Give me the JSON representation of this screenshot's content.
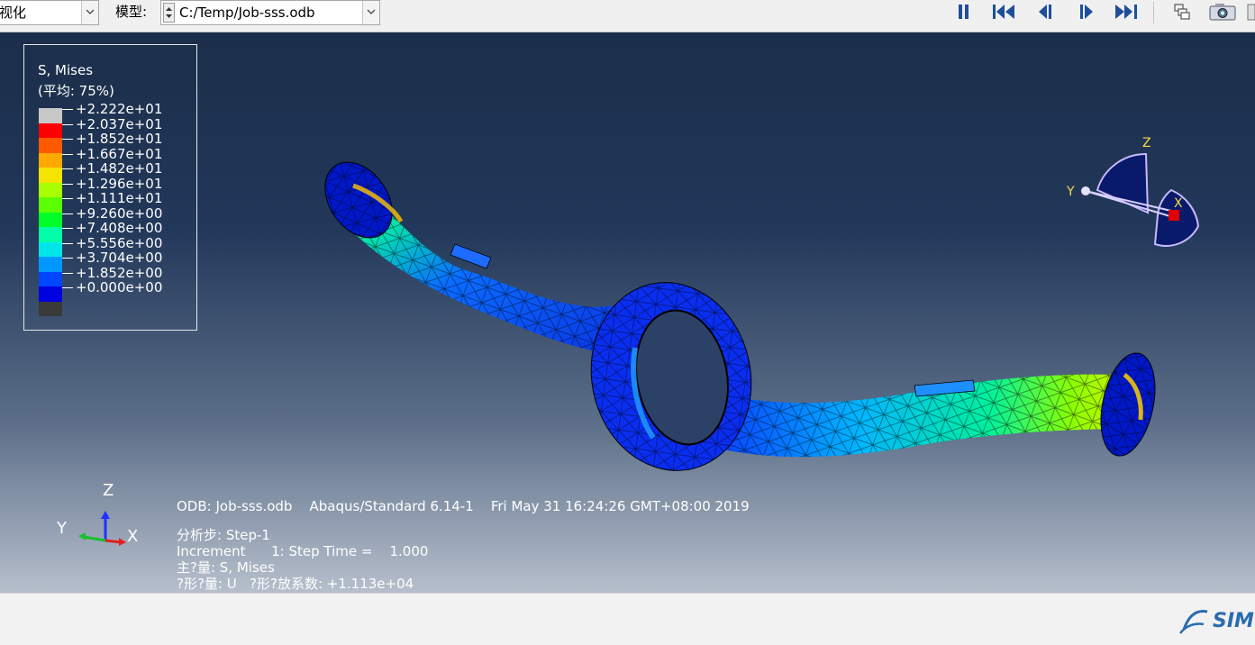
{
  "toolbar": {
    "mode_value": "视化",
    "model_label": "模型:",
    "model_value": "C:/Temp/Job-sss.odb",
    "buttons": [
      "pause-icon",
      "first-frame-icon",
      "previous-frame-icon",
      "next-frame-icon",
      "last-frame-icon",
      "frame-select-icon",
      "camera-icon"
    ]
  },
  "legend": {
    "title": "S, Mises",
    "subtitle": "(平均: 75%)",
    "entries": [
      {
        "value": "+2.222e+01",
        "color": "#c8c8c8"
      },
      {
        "value": "+2.037e+01",
        "color": "#ff0000"
      },
      {
        "value": "+1.852e+01",
        "color": "#ff5a00"
      },
      {
        "value": "+1.667e+01",
        "color": "#ffa900"
      },
      {
        "value": "+1.482e+01",
        "color": "#f4e400"
      },
      {
        "value": "+1.296e+01",
        "color": "#a7ff00"
      },
      {
        "value": "+1.111e+01",
        "color": "#5cff00"
      },
      {
        "value": "+9.260e+00",
        "color": "#00ff29"
      },
      {
        "value": "+7.408e+00",
        "color": "#00ffa6"
      },
      {
        "value": "+5.556e+00",
        "color": "#00e6e8"
      },
      {
        "value": "+3.704e+00",
        "color": "#0098ff"
      },
      {
        "value": "+1.852e+00",
        "color": "#0046ff"
      },
      {
        "value": "+0.000e+00",
        "color": "#0000e0"
      },
      {
        "value": "",
        "color": "#3a3a3a"
      }
    ]
  },
  "info": {
    "line1": "ODB: Job-sss.odb    Abaqus/Standard 6.14-1    Fri May 31 16:24:26 GMT+08:00 2019",
    "line2": "分析步: Step-1",
    "line3": "Increment      1: Step Time =    1.000",
    "line4": "主?量: S, Mises",
    "line5": "?形?量: U   ?形?放系数: +1.113e+04"
  },
  "view_triad": {
    "z": "Z",
    "y": "Y",
    "x": "X"
  },
  "axes": {
    "z": "Z",
    "y": "Y",
    "x": "X"
  },
  "brand": "SIM"
}
